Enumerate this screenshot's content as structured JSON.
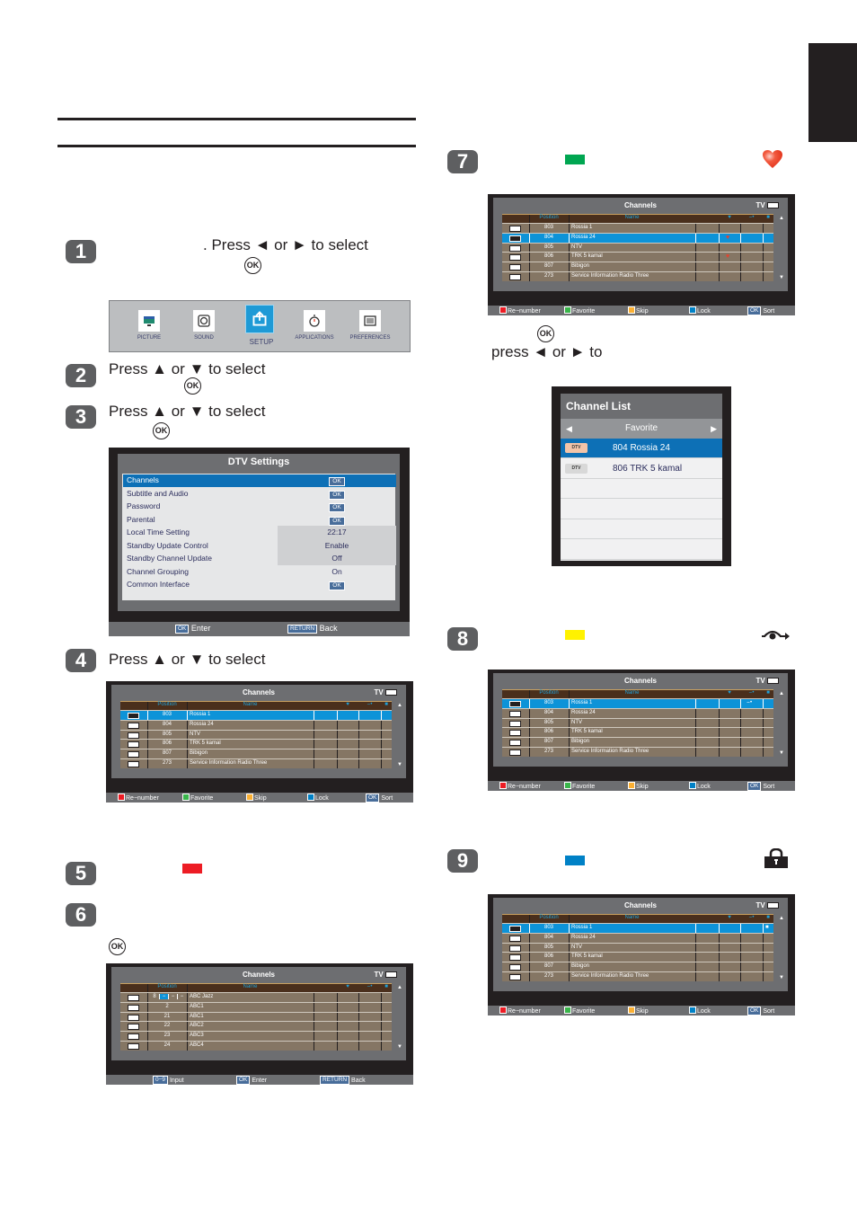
{
  "page": {
    "side_tab_color": "#231f20"
  },
  "steps": [
    {
      "number": "1",
      "text": ". Press ◄ or ► to select",
      "ok": "OK"
    },
    {
      "number": "2",
      "text": "Press ▲ or ▼ to select",
      "ok": "OK"
    },
    {
      "number": "3",
      "text": "Press ▲ or ▼ to select",
      "ok": "OK"
    },
    {
      "number": "4",
      "text": "Press ▲ or ▼ to select"
    },
    {
      "number": "5",
      "color_key": "#ed1c24"
    },
    {
      "number": "6",
      "ok": "OK"
    },
    {
      "number": "7",
      "color_key": "#00a651",
      "icon": "heart-icon",
      "ok": "OK",
      "text_line2": "press ◄ or ► to"
    },
    {
      "number": "8",
      "color_key": "#fff200",
      "icon": "skip-icon"
    },
    {
      "number": "9",
      "color_key": "#0081c6",
      "icon": "lock-icon"
    }
  ],
  "main_menu": {
    "items": [
      {
        "label": "PICTURE",
        "icon": "monitor-icon",
        "active": false
      },
      {
        "label": "SOUND",
        "icon": "speaker-icon",
        "active": false
      },
      {
        "label": "SETUP",
        "icon": "setup-icon",
        "active": true
      },
      {
        "label": "APPLICATIONS",
        "icon": "timer-icon",
        "active": false
      },
      {
        "label": "PREFERENCES",
        "icon": "preferences-icon",
        "active": false
      }
    ]
  },
  "dtv_settings": {
    "title": "DTV Settings",
    "rows": [
      {
        "label": "Channels",
        "value": "OK",
        "type": "button",
        "selected": true
      },
      {
        "label": "Subtitle and Audio",
        "value": "OK",
        "type": "button"
      },
      {
        "label": "Password",
        "value": "OK",
        "type": "button"
      },
      {
        "label": "Parental",
        "value": "OK",
        "type": "button"
      },
      {
        "label": "Local Time Setting",
        "value": "22:17",
        "type": "value"
      },
      {
        "label": "Standby Update Control",
        "value": "Enable",
        "type": "value"
      },
      {
        "label": "Standby Channel Update",
        "value": "Off",
        "type": "value"
      },
      {
        "label": "Channel Grouping",
        "value": "On",
        "type": "plain"
      },
      {
        "label": "Common Interface",
        "value": "OK",
        "type": "button"
      }
    ],
    "footer": {
      "ok_key": "OK",
      "ok_label": "Enter",
      "return_key": "RETURN",
      "return_label": "Back"
    }
  },
  "channels_common": {
    "title": "Channels",
    "source": "TV",
    "col_position": "Position",
    "col_name": "Name",
    "footer": [
      {
        "color": "#ed1c24",
        "label": "Re−number"
      },
      {
        "color": "#39b54a",
        "label": "Favorite"
      },
      {
        "color": "#fbb034",
        "label": "Skip"
      },
      {
        "color": "#0081c6",
        "label": "Lock"
      },
      {
        "key": "OK",
        "label": "Sort"
      }
    ]
  },
  "channels_step4": {
    "rows": [
      {
        "pos": "803",
        "name": "Rossia 1",
        "selected": true
      },
      {
        "pos": "804",
        "name": "Rossia 24"
      },
      {
        "pos": "805",
        "name": "NTV"
      },
      {
        "pos": "806",
        "name": "TRK 5 kamal"
      },
      {
        "pos": "807",
        "name": "Bibigon"
      },
      {
        "pos": "273",
        "name": "Service Information Radio Three"
      }
    ]
  },
  "channels_step6": {
    "rows": [
      {
        "pos": "8 − − −",
        "name": "ABC Jazz",
        "editing": true
      },
      {
        "pos": "2",
        "name": "ABC1"
      },
      {
        "pos": "21",
        "name": "ABC1"
      },
      {
        "pos": "22",
        "name": "ABC2"
      },
      {
        "pos": "23",
        "name": "ABC3"
      },
      {
        "pos": "24",
        "name": "ABC4"
      }
    ],
    "footer": [
      {
        "key": "0−9",
        "label": "Input"
      },
      {
        "key": "OK",
        "label": "Enter"
      },
      {
        "key": "RETURN",
        "label": "Back"
      }
    ]
  },
  "channels_step7": {
    "rows": [
      {
        "pos": "803",
        "name": "Rossia 1"
      },
      {
        "pos": "804",
        "name": "Rossia 24",
        "selected": true,
        "favorite": true
      },
      {
        "pos": "805",
        "name": "NTV"
      },
      {
        "pos": "806",
        "name": "TRK 5 kamal",
        "favorite": true
      },
      {
        "pos": "807",
        "name": "Bibigon"
      },
      {
        "pos": "273",
        "name": "Service Information Radio Three"
      }
    ]
  },
  "channel_list_popup": {
    "title": "Channel List",
    "filter": "Favorite",
    "rows": [
      {
        "badge": "DTV",
        "text": "804  Rossia 24",
        "selected": true
      },
      {
        "badge": "DTV",
        "text": "806  TRK 5 kamal"
      }
    ]
  },
  "channels_step8": {
    "rows": [
      {
        "pos": "803",
        "name": "Rossia 1",
        "selected": true,
        "skip": true
      },
      {
        "pos": "804",
        "name": "Rossia 24"
      },
      {
        "pos": "805",
        "name": "NTV"
      },
      {
        "pos": "806",
        "name": "TRK 5 kamal"
      },
      {
        "pos": "807",
        "name": "Bibigon"
      },
      {
        "pos": "273",
        "name": "Service Information Radio Three"
      }
    ]
  },
  "channels_step9": {
    "rows": [
      {
        "pos": "803",
        "name": "Rossia 1",
        "selected": true,
        "lock": true
      },
      {
        "pos": "804",
        "name": "Rossia 24"
      },
      {
        "pos": "805",
        "name": "NTV"
      },
      {
        "pos": "806",
        "name": "TRK 5 kamal"
      },
      {
        "pos": "807",
        "name": "Bibigon"
      },
      {
        "pos": "273",
        "name": "Service Information Radio Three"
      }
    ]
  }
}
